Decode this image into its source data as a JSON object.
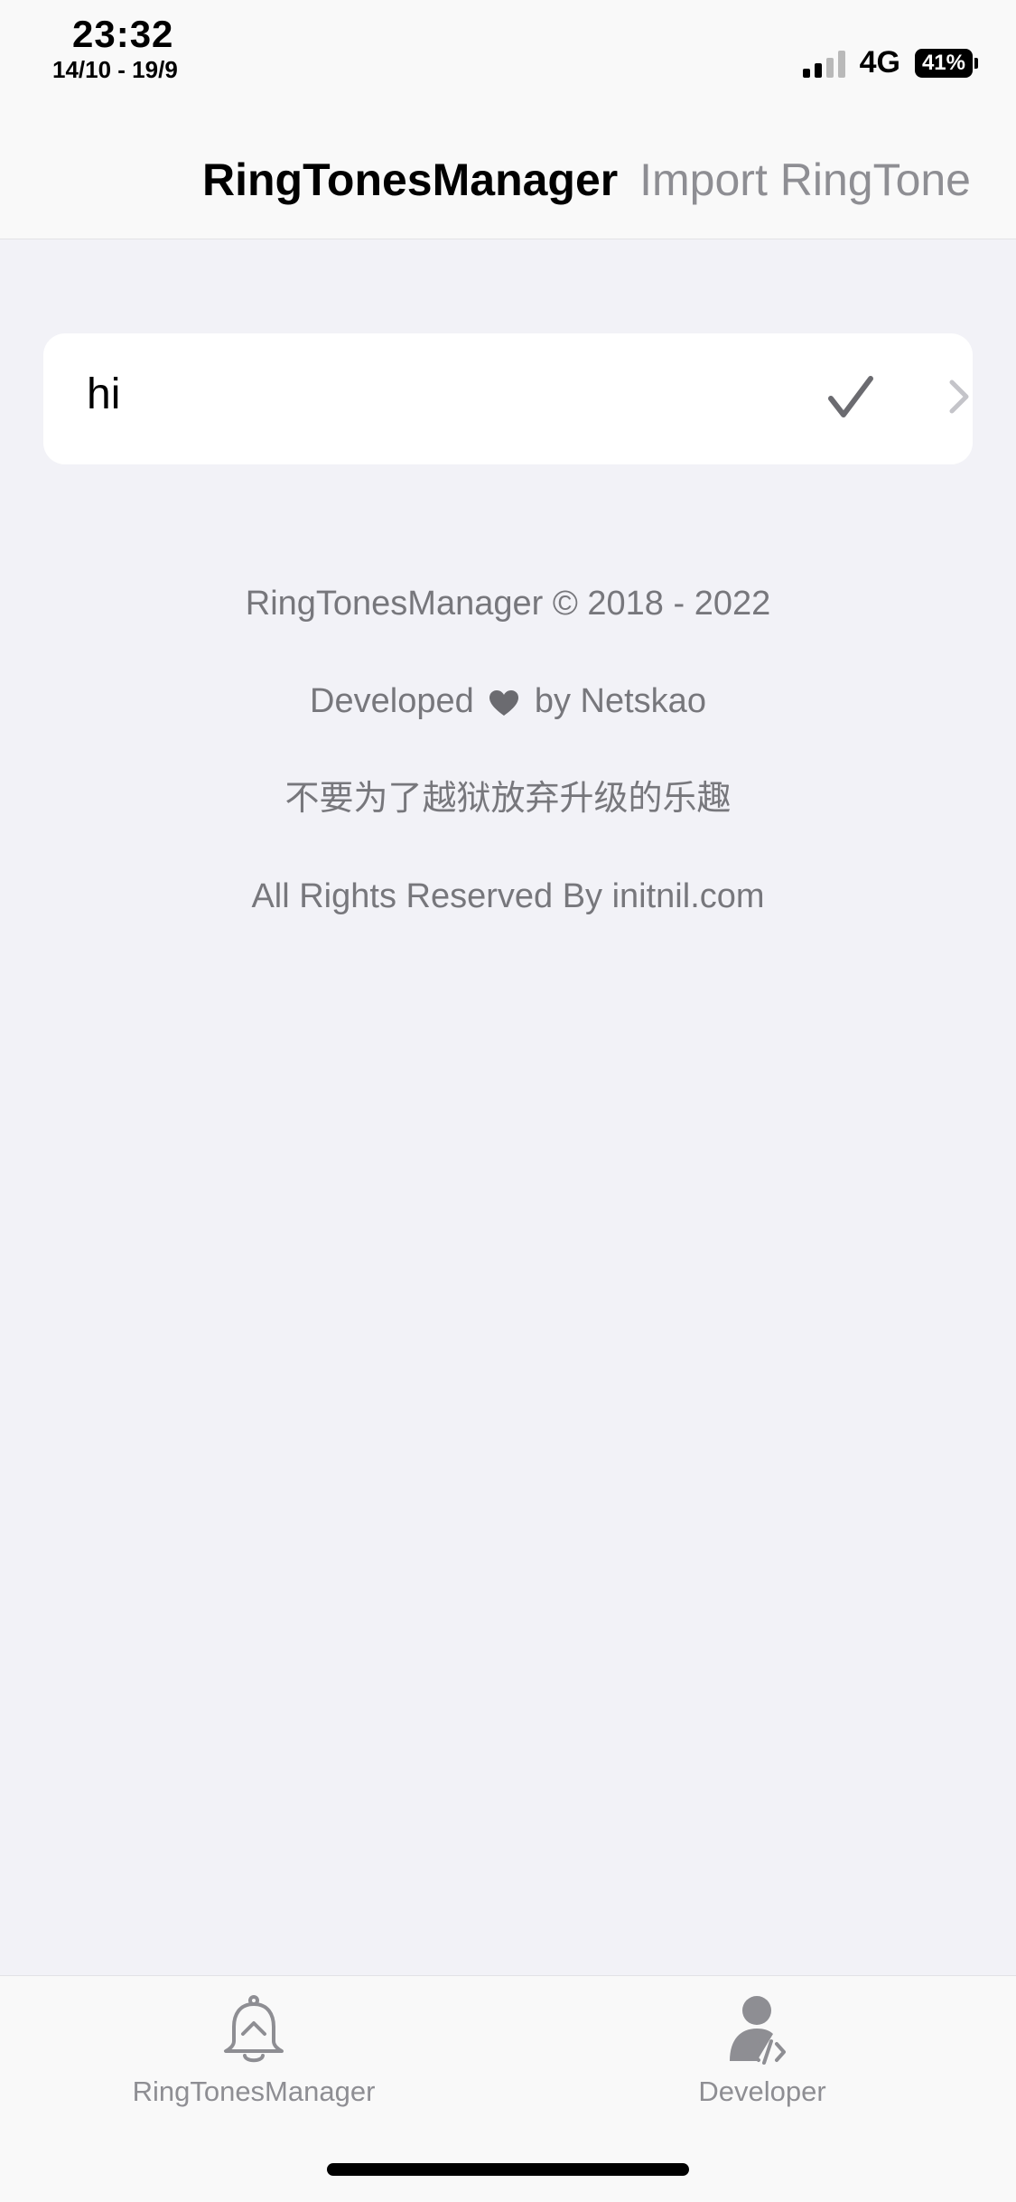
{
  "status_bar": {
    "time": "23:32",
    "date": "14/10 - 19/9",
    "network": "4G",
    "battery": "41%"
  },
  "nav": {
    "title": "RingTonesManager",
    "action": "Import RingTone"
  },
  "list": {
    "items": [
      {
        "label": "hi",
        "selected": true
      }
    ]
  },
  "footer": {
    "copyright": "RingTonesManager © 2018 - 2022",
    "developed_prefix": "Developed",
    "developed_suffix": "by Netskao",
    "slogan": "不要为了越狱放弃升级的乐趣",
    "rights": "All Rights Reserved By initnil.com"
  },
  "tabs": [
    {
      "label": "RingTonesManager",
      "icon": "bell-icon"
    },
    {
      "label": "Developer",
      "icon": "developer-icon"
    }
  ],
  "colors": {
    "background": "#f2f2f7",
    "secondary_text": "#8e8e93",
    "footer_text": "#77777c"
  }
}
